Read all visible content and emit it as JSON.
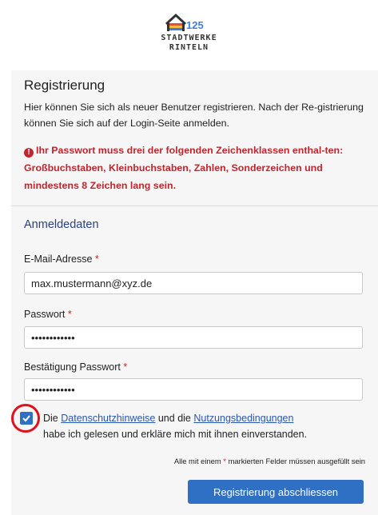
{
  "brand": {
    "logo_badge": "125",
    "logo_line1": "STADTWERKE",
    "logo_line2": "RINTELN"
  },
  "page": {
    "title": "Registrierung",
    "intro": "Hier können Sie sich als neuer Benutzer registrieren. Nach der Re-gistrierung können Sie sich auf der Login-Seite anmelden.",
    "warning": "Ihr Passwort muss drei der folgenden Zeichenklassen enthal-ten: Großbuchstaben, Kleinbuchstaben, Zahlen, Sonderzeichen und mindestens 8 Zeichen lang sein.",
    "warning_icon": "!"
  },
  "form": {
    "section_title": "Anmeldedaten",
    "required_marker": "*",
    "email": {
      "label": "E-Mail-Adresse",
      "value": "max.mustermann@xyz.de"
    },
    "password": {
      "label": "Passwort",
      "value": "••••••••••••"
    },
    "confirm": {
      "label": "Bestätigung Passwort",
      "value": "••••••••••••"
    },
    "consent": {
      "checked": true,
      "prefix": "Die",
      "link1": "Datenschutzhinweise",
      "middle": "und die",
      "link2": "Nutzungsbedingungen",
      "suffix": "habe ich gelesen und erkläre mich mit ihnen einverstanden."
    },
    "required_note_prefix": "Alle mit einem",
    "required_note_suffix": "markierten Felder müssen ausgefüllt sein",
    "submit_label": "Registrierung abschliessen"
  },
  "colors": {
    "accent": "#2f6fc4",
    "error": "#c0262d",
    "section": "#2a3f84",
    "highlight_ring": "#e0101d"
  },
  "icons": {
    "logo": "house-logo-icon",
    "warning": "exclamation-circle-icon",
    "checkbox": "checkmark-icon"
  }
}
